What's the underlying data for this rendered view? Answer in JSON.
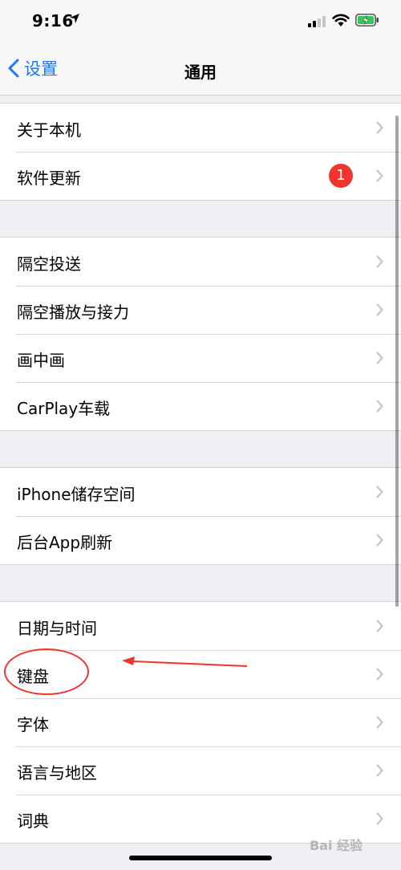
{
  "status_bar": {
    "time": "9:16"
  },
  "nav": {
    "back_label": "设置",
    "title": "通用"
  },
  "groups": [
    {
      "rows": [
        {
          "label": "关于本机"
        },
        {
          "label": "软件更新",
          "badge": "1"
        }
      ]
    },
    {
      "rows": [
        {
          "label": "隔空投送"
        },
        {
          "label": "隔空播放与接力"
        },
        {
          "label": "画中画"
        },
        {
          "label": "CarPlay车载"
        }
      ]
    },
    {
      "rows": [
        {
          "label": "iPhone储存空间"
        },
        {
          "label": "后台App刷新"
        }
      ]
    },
    {
      "rows": [
        {
          "label": "日期与时间"
        },
        {
          "label": "键盘"
        },
        {
          "label": "字体"
        },
        {
          "label": "语言与地区"
        },
        {
          "label": "词典"
        }
      ]
    }
  ],
  "watermark": "Bai 经验",
  "colors": {
    "accent": "#1a7af8",
    "badge": "#f0352d",
    "annotation": "#e33333",
    "battery": "#34c759"
  }
}
